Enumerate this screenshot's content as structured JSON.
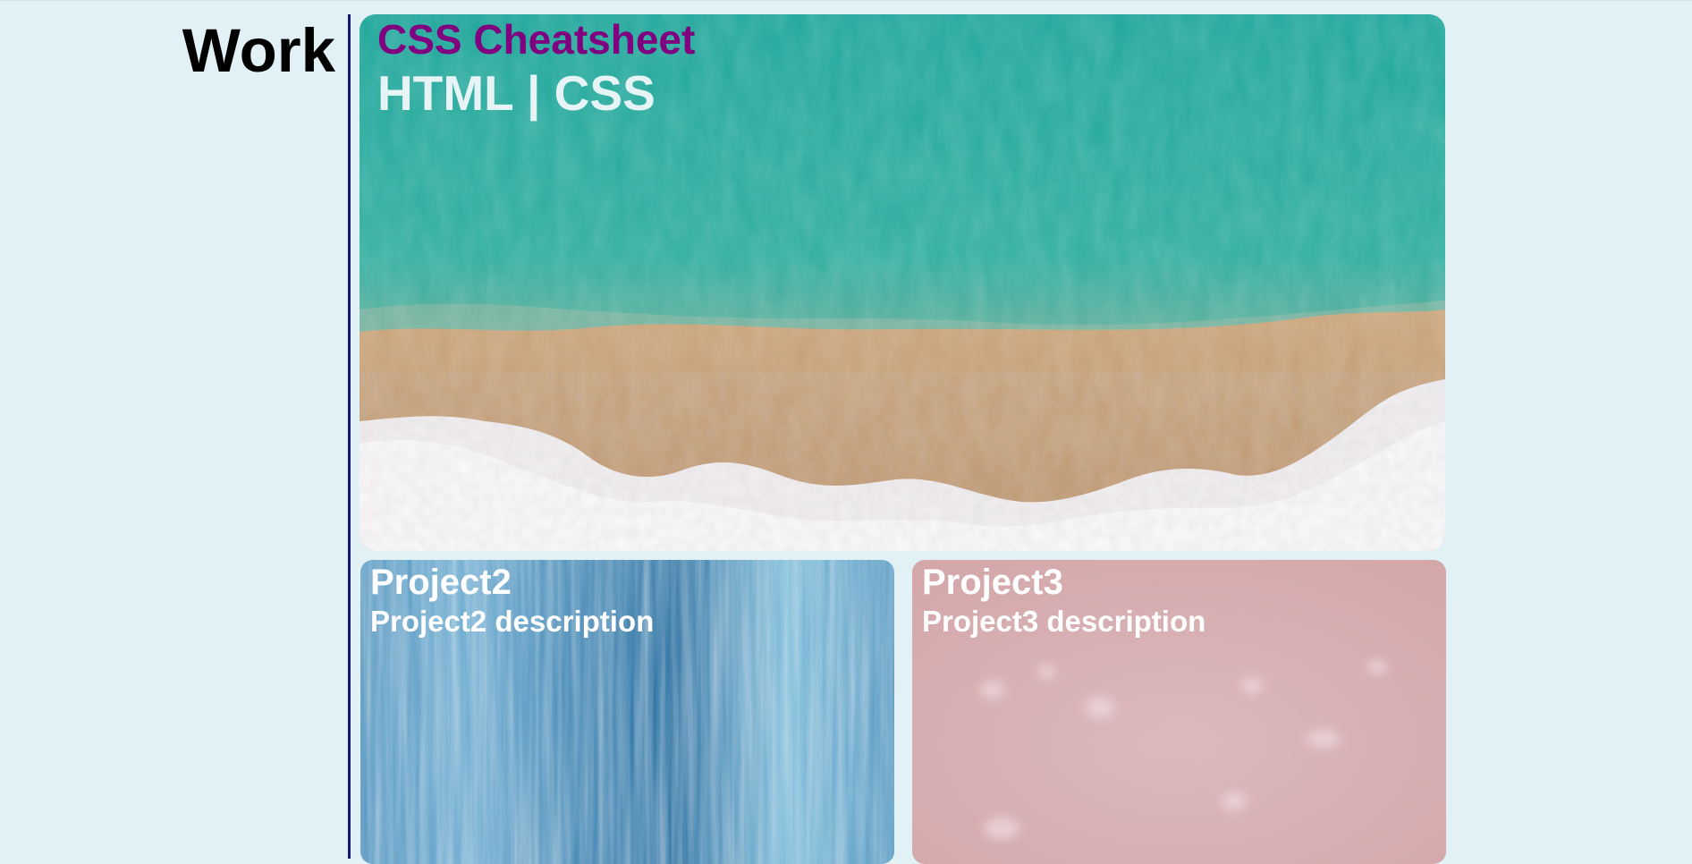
{
  "work": {
    "heading": "Work"
  },
  "featured": {
    "title": "CSS Cheatsheet",
    "tags": "HTML | CSS"
  },
  "projects": [
    {
      "title": "Project2",
      "description": "Project2 description"
    },
    {
      "title": "Project3",
      "description": "Project3 description"
    }
  ],
  "colors": {
    "page_background": "#e2f1f6",
    "divider": "#141a6e",
    "featured_title": "#800080",
    "featured_tags": "#e7f4f6",
    "project_text": "#ffffff"
  }
}
